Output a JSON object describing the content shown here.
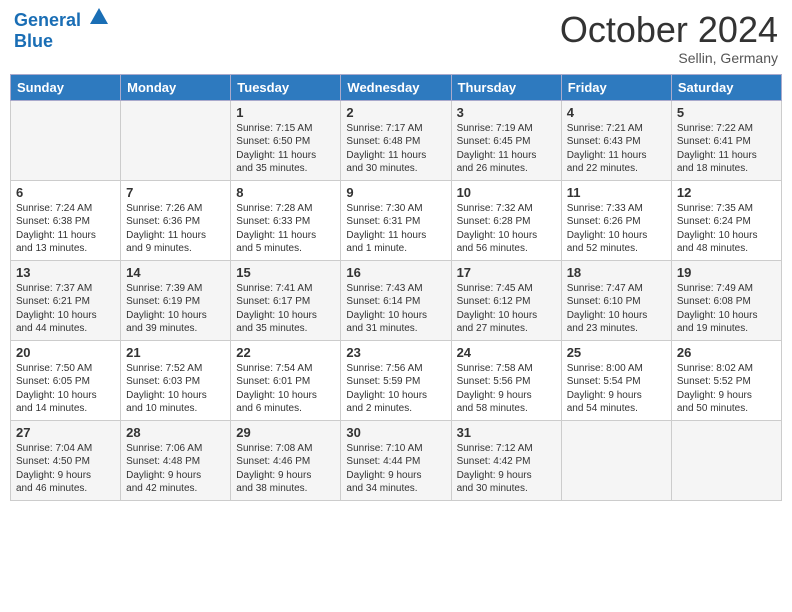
{
  "header": {
    "logo_line1": "General",
    "logo_line2": "Blue",
    "month": "October 2024",
    "location": "Sellin, Germany"
  },
  "days_of_week": [
    "Sunday",
    "Monday",
    "Tuesday",
    "Wednesday",
    "Thursday",
    "Friday",
    "Saturday"
  ],
  "weeks": [
    [
      {
        "day": "",
        "info": ""
      },
      {
        "day": "",
        "info": ""
      },
      {
        "day": "1",
        "info": "Sunrise: 7:15 AM\nSunset: 6:50 PM\nDaylight: 11 hours\nand 35 minutes."
      },
      {
        "day": "2",
        "info": "Sunrise: 7:17 AM\nSunset: 6:48 PM\nDaylight: 11 hours\nand 30 minutes."
      },
      {
        "day": "3",
        "info": "Sunrise: 7:19 AM\nSunset: 6:45 PM\nDaylight: 11 hours\nand 26 minutes."
      },
      {
        "day": "4",
        "info": "Sunrise: 7:21 AM\nSunset: 6:43 PM\nDaylight: 11 hours\nand 22 minutes."
      },
      {
        "day": "5",
        "info": "Sunrise: 7:22 AM\nSunset: 6:41 PM\nDaylight: 11 hours\nand 18 minutes."
      }
    ],
    [
      {
        "day": "6",
        "info": "Sunrise: 7:24 AM\nSunset: 6:38 PM\nDaylight: 11 hours\nand 13 minutes."
      },
      {
        "day": "7",
        "info": "Sunrise: 7:26 AM\nSunset: 6:36 PM\nDaylight: 11 hours\nand 9 minutes."
      },
      {
        "day": "8",
        "info": "Sunrise: 7:28 AM\nSunset: 6:33 PM\nDaylight: 11 hours\nand 5 minutes."
      },
      {
        "day": "9",
        "info": "Sunrise: 7:30 AM\nSunset: 6:31 PM\nDaylight: 11 hours\nand 1 minute."
      },
      {
        "day": "10",
        "info": "Sunrise: 7:32 AM\nSunset: 6:28 PM\nDaylight: 10 hours\nand 56 minutes."
      },
      {
        "day": "11",
        "info": "Sunrise: 7:33 AM\nSunset: 6:26 PM\nDaylight: 10 hours\nand 52 minutes."
      },
      {
        "day": "12",
        "info": "Sunrise: 7:35 AM\nSunset: 6:24 PM\nDaylight: 10 hours\nand 48 minutes."
      }
    ],
    [
      {
        "day": "13",
        "info": "Sunrise: 7:37 AM\nSunset: 6:21 PM\nDaylight: 10 hours\nand 44 minutes."
      },
      {
        "day": "14",
        "info": "Sunrise: 7:39 AM\nSunset: 6:19 PM\nDaylight: 10 hours\nand 39 minutes."
      },
      {
        "day": "15",
        "info": "Sunrise: 7:41 AM\nSunset: 6:17 PM\nDaylight: 10 hours\nand 35 minutes."
      },
      {
        "day": "16",
        "info": "Sunrise: 7:43 AM\nSunset: 6:14 PM\nDaylight: 10 hours\nand 31 minutes."
      },
      {
        "day": "17",
        "info": "Sunrise: 7:45 AM\nSunset: 6:12 PM\nDaylight: 10 hours\nand 27 minutes."
      },
      {
        "day": "18",
        "info": "Sunrise: 7:47 AM\nSunset: 6:10 PM\nDaylight: 10 hours\nand 23 minutes."
      },
      {
        "day": "19",
        "info": "Sunrise: 7:49 AM\nSunset: 6:08 PM\nDaylight: 10 hours\nand 19 minutes."
      }
    ],
    [
      {
        "day": "20",
        "info": "Sunrise: 7:50 AM\nSunset: 6:05 PM\nDaylight: 10 hours\nand 14 minutes."
      },
      {
        "day": "21",
        "info": "Sunrise: 7:52 AM\nSunset: 6:03 PM\nDaylight: 10 hours\nand 10 minutes."
      },
      {
        "day": "22",
        "info": "Sunrise: 7:54 AM\nSunset: 6:01 PM\nDaylight: 10 hours\nand 6 minutes."
      },
      {
        "day": "23",
        "info": "Sunrise: 7:56 AM\nSunset: 5:59 PM\nDaylight: 10 hours\nand 2 minutes."
      },
      {
        "day": "24",
        "info": "Sunrise: 7:58 AM\nSunset: 5:56 PM\nDaylight: 9 hours\nand 58 minutes."
      },
      {
        "day": "25",
        "info": "Sunrise: 8:00 AM\nSunset: 5:54 PM\nDaylight: 9 hours\nand 54 minutes."
      },
      {
        "day": "26",
        "info": "Sunrise: 8:02 AM\nSunset: 5:52 PM\nDaylight: 9 hours\nand 50 minutes."
      }
    ],
    [
      {
        "day": "27",
        "info": "Sunrise: 7:04 AM\nSunset: 4:50 PM\nDaylight: 9 hours\nand 46 minutes."
      },
      {
        "day": "28",
        "info": "Sunrise: 7:06 AM\nSunset: 4:48 PM\nDaylight: 9 hours\nand 42 minutes."
      },
      {
        "day": "29",
        "info": "Sunrise: 7:08 AM\nSunset: 4:46 PM\nDaylight: 9 hours\nand 38 minutes."
      },
      {
        "day": "30",
        "info": "Sunrise: 7:10 AM\nSunset: 4:44 PM\nDaylight: 9 hours\nand 34 minutes."
      },
      {
        "day": "31",
        "info": "Sunrise: 7:12 AM\nSunset: 4:42 PM\nDaylight: 9 hours\nand 30 minutes."
      },
      {
        "day": "",
        "info": ""
      },
      {
        "day": "",
        "info": ""
      }
    ]
  ]
}
